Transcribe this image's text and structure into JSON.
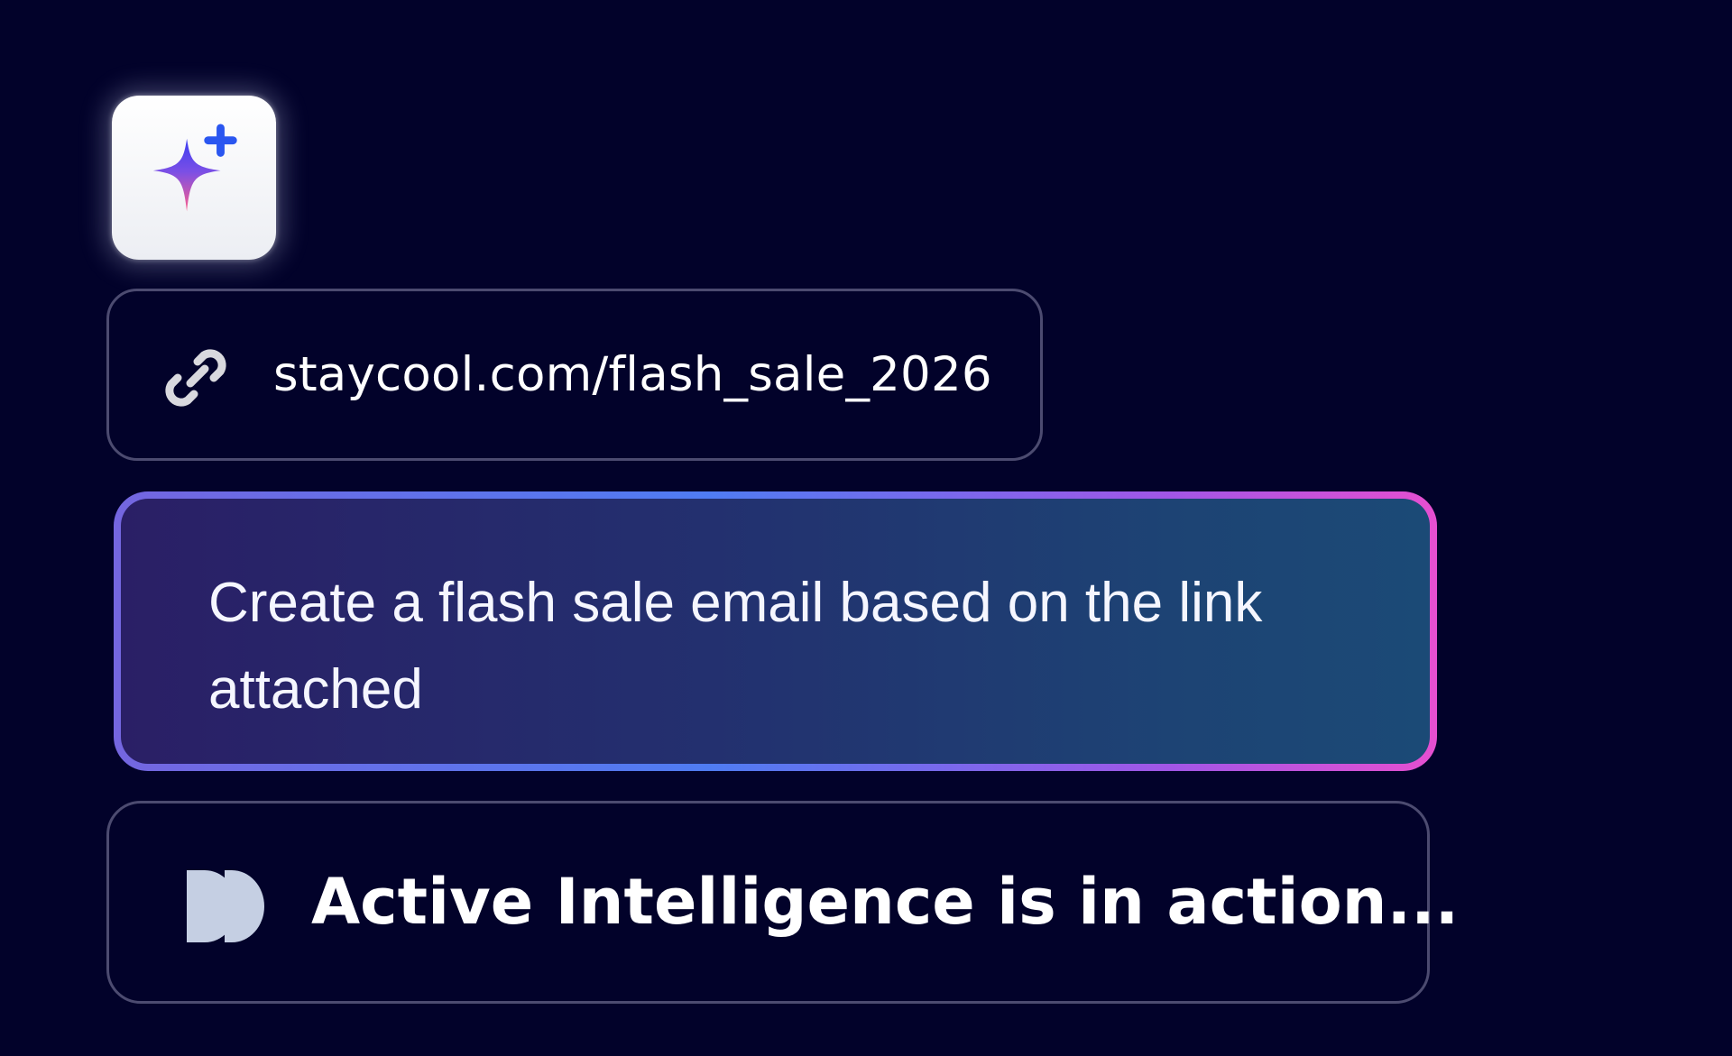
{
  "badge": {
    "icon": "sparkle-plus-icon"
  },
  "link_chip": {
    "icon": "link-icon",
    "url": "staycool.com/flash_sale_2026"
  },
  "prompt": {
    "text": "Create a flash sale email based on the link attached"
  },
  "status": {
    "icon": "double-play-icon",
    "text": "Active Intelligence is in action..."
  },
  "colors": {
    "background": "#02022a",
    "border": "#4c4b70",
    "gradient_start": "#7466e0",
    "gradient_mid": "#4f7cf2",
    "gradient_end": "#e64fd0",
    "status_icon": "#c5cfe3"
  }
}
